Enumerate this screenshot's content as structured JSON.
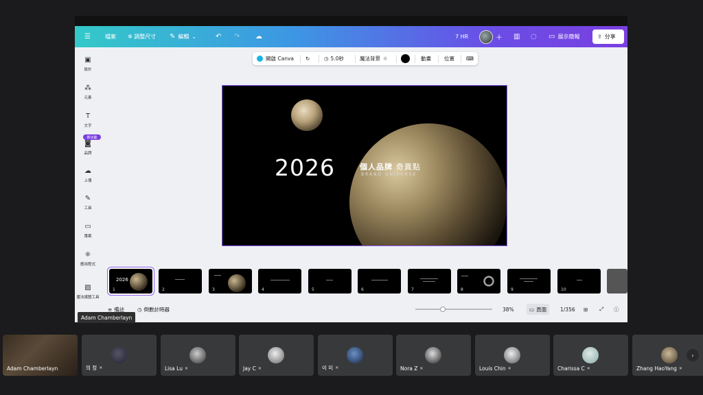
{
  "topbar": {
    "menu_icon": "hamburger-icon",
    "file_label": "檔案",
    "resize_label": "✲ 調整尺寸",
    "edit_label": "編輯",
    "hours_label": "7 HR",
    "present_label": "展示簡報",
    "share_label": "分享"
  },
  "toolbar": {
    "open_canva_label": "開啟 Canva",
    "duration_label": "5.0秒",
    "magic_bg_label": "魔法背景",
    "animate_label": "動畫",
    "position_label": "位置"
  },
  "sidebar": {
    "items": [
      {
        "label": "設計",
        "icon": "design-icon"
      },
      {
        "label": "元素",
        "icon": "elements-icon"
      },
      {
        "label": "文字",
        "icon": "text-icon"
      },
      {
        "label": "品牌",
        "icon": "brand-icon"
      },
      {
        "label": "上傳",
        "icon": "upload-icon"
      },
      {
        "label": "工具",
        "icon": "tools-icon"
      },
      {
        "label": "專案",
        "icon": "projects-icon"
      },
      {
        "label": "應用程式",
        "icon": "apps-icon"
      },
      {
        "label": "魔法媒體工具",
        "icon": "magic-media-icon"
      }
    ],
    "new_badge": "新功能"
  },
  "slide": {
    "year": "2026",
    "title_cn_bold": "個人品牌",
    "title_cn_light": "奇異點",
    "subtitle_en": "BRAND UNIVERSE"
  },
  "thumbnails": [
    "1",
    "2",
    "3",
    "4",
    "5",
    "6",
    "7",
    "8",
    "9",
    "10"
  ],
  "bottombar": {
    "notes_label": "備註",
    "timer_label": "倒數計時器",
    "zoom": "38%",
    "pages_label": "頁面",
    "page_count": "1/356"
  },
  "tooltip": "Adam Chamberlayn",
  "participants": [
    {
      "name": "Adam Chamberlayn",
      "mic": false
    },
    {
      "name": "의 정",
      "mic": true
    },
    {
      "name": "Lisa Lu",
      "mic": true
    },
    {
      "name": "Jay C",
      "mic": true
    },
    {
      "name": "이 미",
      "mic": true
    },
    {
      "name": "Nora Z",
      "mic": true
    },
    {
      "name": "Louis Chin",
      "mic": true
    },
    {
      "name": "Charissa C",
      "mic": true
    },
    {
      "name": "Zhang HaoYang",
      "mic": true
    }
  ]
}
